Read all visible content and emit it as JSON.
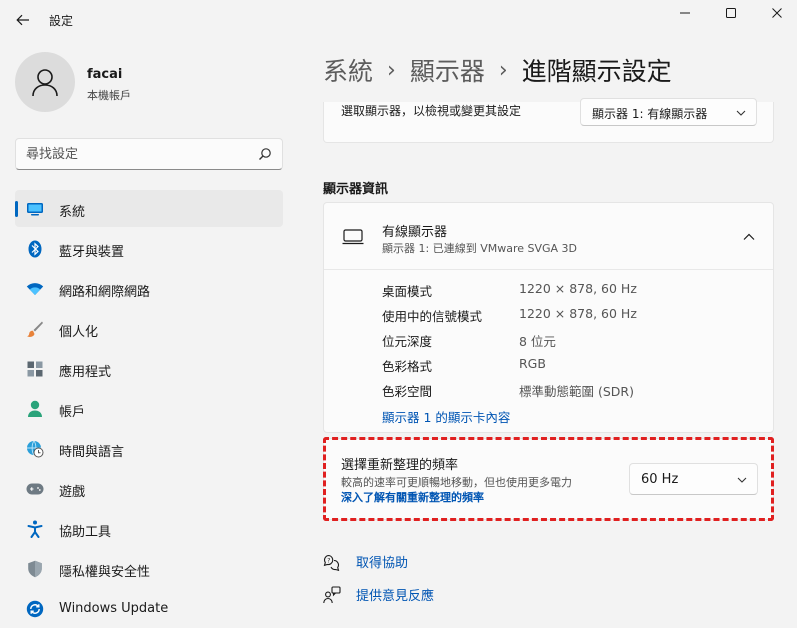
{
  "window": {
    "title": "設定"
  },
  "profile": {
    "name": "facai",
    "account_type": "本機帳戶"
  },
  "search": {
    "placeholder": "尋找設定"
  },
  "nav": {
    "items": [
      {
        "label": "系統",
        "icon": "system-icon",
        "active": true
      },
      {
        "label": "藍牙與裝置",
        "icon": "bluetooth-icon"
      },
      {
        "label": "網路和網際網路",
        "icon": "wifi-icon"
      },
      {
        "label": "個人化",
        "icon": "brush-icon"
      },
      {
        "label": "應用程式",
        "icon": "apps-icon"
      },
      {
        "label": "帳戶",
        "icon": "account-icon"
      },
      {
        "label": "時間與語言",
        "icon": "globe-clock-icon"
      },
      {
        "label": "遊戲",
        "icon": "gamepad-icon"
      },
      {
        "label": "協助工具",
        "icon": "accessibility-icon"
      },
      {
        "label": "隱私權與安全性",
        "icon": "shield-icon"
      },
      {
        "label": "Windows Update",
        "icon": "update-icon"
      }
    ]
  },
  "breadcrumb": {
    "items": [
      "系統",
      "顯示器",
      "進階顯示設定"
    ],
    "separator": "›"
  },
  "display_select": {
    "label": "選取顯示器，以檢視或變更其設定",
    "value": "顯示器 1: 有線顯示器"
  },
  "display_info": {
    "section_title": "顯示器資訊",
    "title": "有線顯示器",
    "subtitle": "顯示器 1: 已連線到 VMware SVGA 3D",
    "rows": [
      {
        "key": "桌面模式",
        "value": "1220 × 878, 60 Hz"
      },
      {
        "key": "使用中的信號模式",
        "value": "1220 × 878, 60 Hz"
      },
      {
        "key": "位元深度",
        "value": "8 位元"
      },
      {
        "key": "色彩格式",
        "value": "RGB"
      },
      {
        "key": "色彩空間",
        "value": "標準動態範圍 (SDR)"
      }
    ],
    "adapter_link": "顯示器 1 的顯示卡內容"
  },
  "refresh_rate": {
    "title": "選擇重新整理的頻率",
    "description": "較高的速率可更順暢地移動，但也使用更多電力",
    "learn_more": "深入了解有關重新整理的頻率",
    "value": "60 Hz"
  },
  "footer": {
    "help": "取得協助",
    "feedback": "提供意見反應"
  },
  "colors": {
    "accent": "#0067c0",
    "link": "#0055b3",
    "highlight_outline": "#e02020"
  }
}
